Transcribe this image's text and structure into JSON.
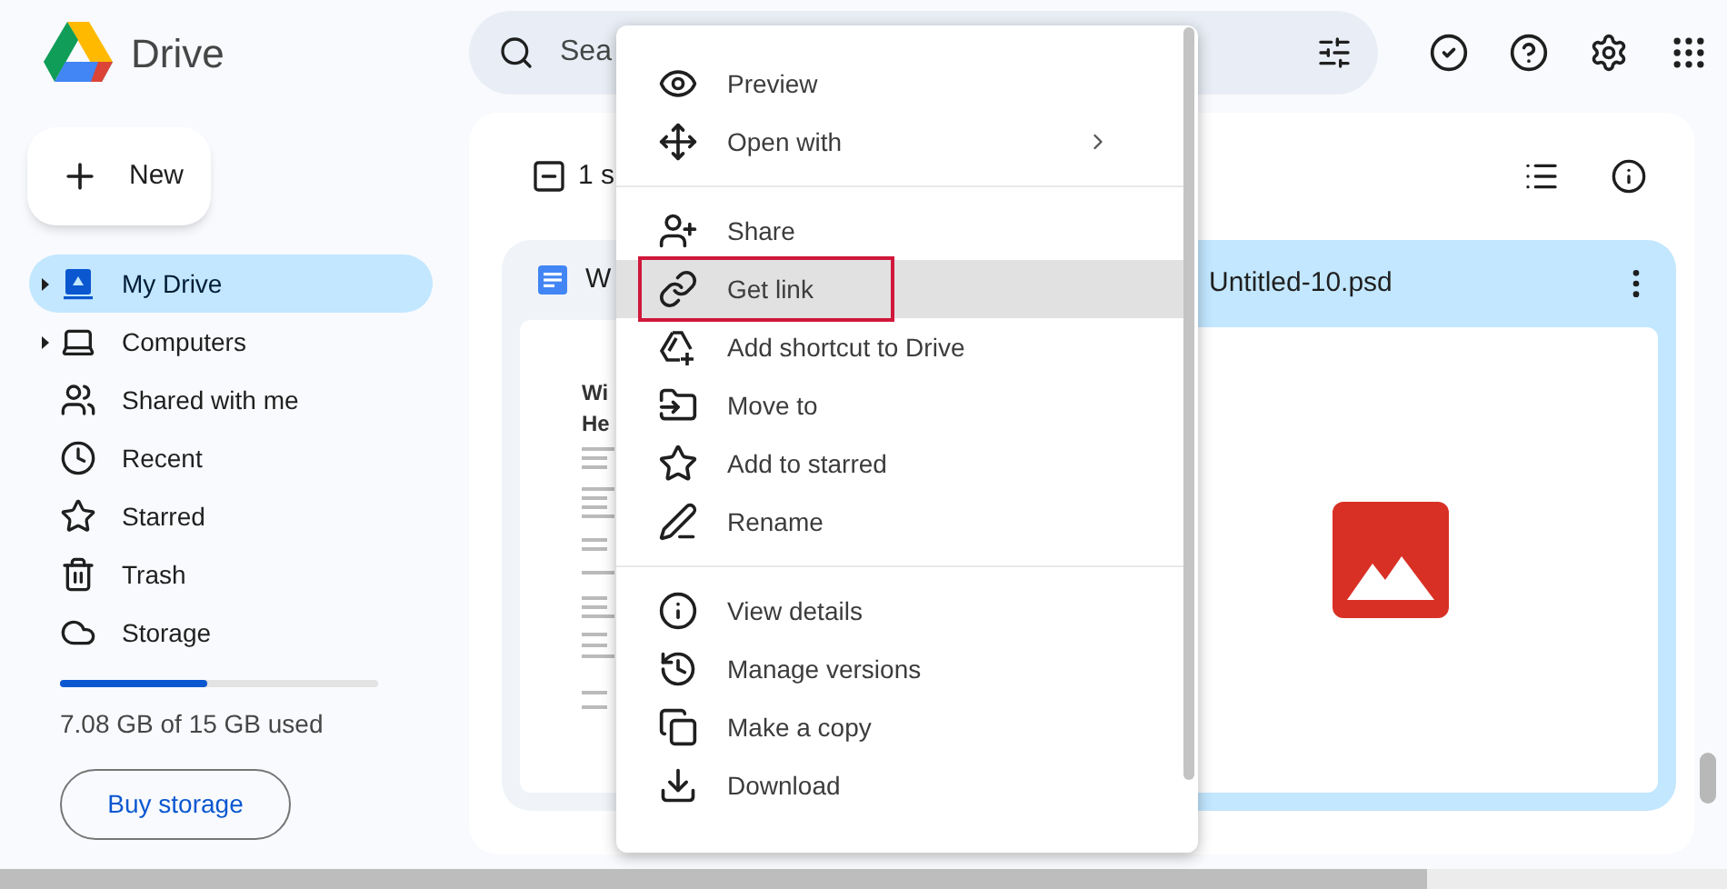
{
  "app": {
    "title": "Drive"
  },
  "search": {
    "text": "Sea"
  },
  "new_button": {
    "label": "New"
  },
  "sidebar": {
    "items": [
      {
        "label": "My Drive",
        "selected": true,
        "expandable": true
      },
      {
        "label": "Computers",
        "selected": false,
        "expandable": true
      },
      {
        "label": "Shared with me",
        "selected": false,
        "expandable": false
      },
      {
        "label": "Recent",
        "selected": false,
        "expandable": false
      },
      {
        "label": "Starred",
        "selected": false,
        "expandable": false
      },
      {
        "label": "Trash",
        "selected": false,
        "expandable": false
      },
      {
        "label": "Storage",
        "selected": false,
        "expandable": false
      }
    ]
  },
  "storage": {
    "level": 0.46,
    "usage": "7.08 GB of 15 GB used",
    "button": "Buy storage"
  },
  "toolbar": {
    "selection": "1 s"
  },
  "files": [
    {
      "name": "W",
      "kind": "doc",
      "selected": false,
      "preview_lines": [
        "Wi",
        "He"
      ]
    },
    {
      "name": "Untitled-10.psd",
      "kind": "image",
      "selected": true
    }
  ],
  "context_menu": {
    "groups": [
      [
        {
          "label": "Preview",
          "highlighted": false,
          "outlined": false,
          "submenu": false
        },
        {
          "label": "Open with",
          "highlighted": false,
          "outlined": false,
          "submenu": true
        }
      ],
      [
        {
          "label": "Share",
          "highlighted": false,
          "outlined": false,
          "submenu": false
        },
        {
          "label": "Get link",
          "highlighted": true,
          "outlined": true,
          "submenu": false
        },
        {
          "label": "Add shortcut to Drive",
          "highlighted": false,
          "outlined": false,
          "submenu": false
        },
        {
          "label": "Move to",
          "highlighted": false,
          "outlined": false,
          "submenu": false
        },
        {
          "label": "Add to starred",
          "highlighted": false,
          "outlined": false,
          "submenu": false
        },
        {
          "label": "Rename",
          "highlighted": false,
          "outlined": false,
          "submenu": false
        }
      ],
      [
        {
          "label": "View details",
          "highlighted": false,
          "outlined": false,
          "submenu": false
        },
        {
          "label": "Manage versions",
          "highlighted": false,
          "outlined": false,
          "submenu": false
        },
        {
          "label": "Make a copy",
          "highlighted": false,
          "outlined": false,
          "submenu": false
        },
        {
          "label": "Download",
          "highlighted": false,
          "outlined": false,
          "submenu": false
        }
      ]
    ]
  }
}
